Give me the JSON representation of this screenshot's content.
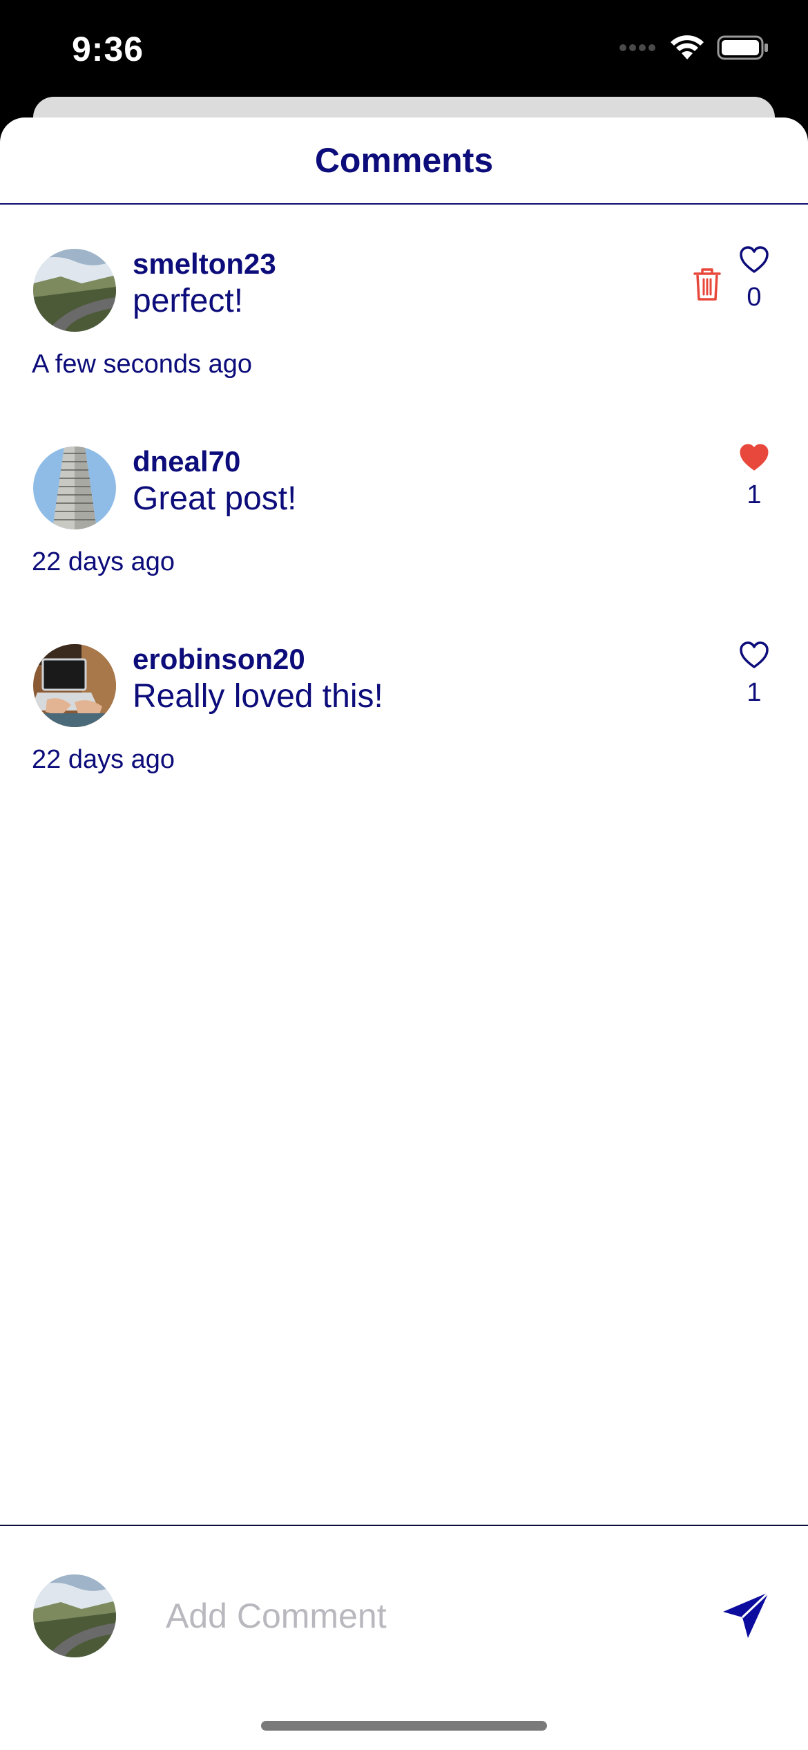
{
  "status_bar": {
    "time": "9:36"
  },
  "header": {
    "title": "Comments"
  },
  "comments": [
    {
      "username": "smelton23",
      "text": "perfect!",
      "timestamp": "A few seconds ago",
      "likes": "0",
      "liked": false,
      "deletable": true,
      "avatar": "mountain-road-avatar"
    },
    {
      "username": "dneal70",
      "text": "Great post!",
      "timestamp": "22 days ago",
      "likes": "1",
      "liked": true,
      "deletable": false,
      "avatar": "skyscraper-avatar"
    },
    {
      "username": "erobinson20",
      "text": "Really loved this!",
      "timestamp": "22 days ago",
      "likes": "1",
      "liked": false,
      "deletable": false,
      "avatar": "laptop-avatar"
    }
  ],
  "composer": {
    "placeholder": "Add Comment",
    "value": ""
  },
  "colors": {
    "primary": "#0c0c7a",
    "accent_red": "#e8483b",
    "placeholder": "#b8b8be"
  }
}
